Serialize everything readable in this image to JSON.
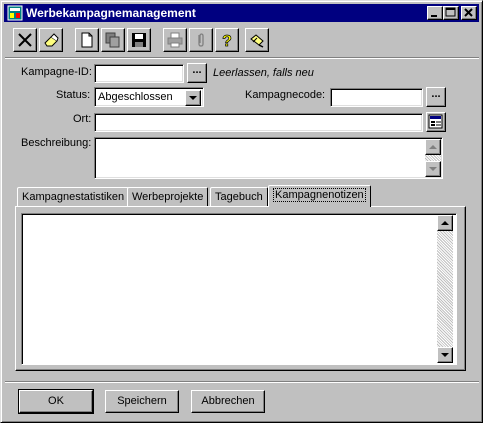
{
  "window": {
    "title": "Werbekampagnemanagement"
  },
  "form": {
    "kampagne_id_label": "Kampagne-ID:",
    "kampagne_id_value": "",
    "kampagne_id_hint": "Leerlassen, falls neu",
    "status_label": "Status:",
    "status_value": "Abgeschlossen",
    "kampagnecode_label": "Kampagnecode:",
    "kampagnecode_value": "",
    "ort_label": "Ort:",
    "ort_value": "",
    "beschreibung_label": "Beschreibung:",
    "beschreibung_value": "",
    "browse_label": "..."
  },
  "tabs": [
    {
      "label": "Kampagnestatistiken"
    },
    {
      "label": "Werbeprojekte"
    },
    {
      "label": "Tagebuch"
    },
    {
      "label": "Kampagnenotizen"
    }
  ],
  "notes_value": "",
  "buttons": {
    "ok": "OK",
    "save": "Speichern",
    "cancel": "Abbrechen"
  },
  "colors": {
    "titlebar": "#000080",
    "face": "#c0c0c0"
  },
  "icons": [
    "close-record-icon",
    "eraser-icon",
    "new-document-icon",
    "copy-icon",
    "save-disk-icon",
    "print-icon",
    "attach-paperclip-icon",
    "help-icon",
    "pen-hand-icon"
  ]
}
